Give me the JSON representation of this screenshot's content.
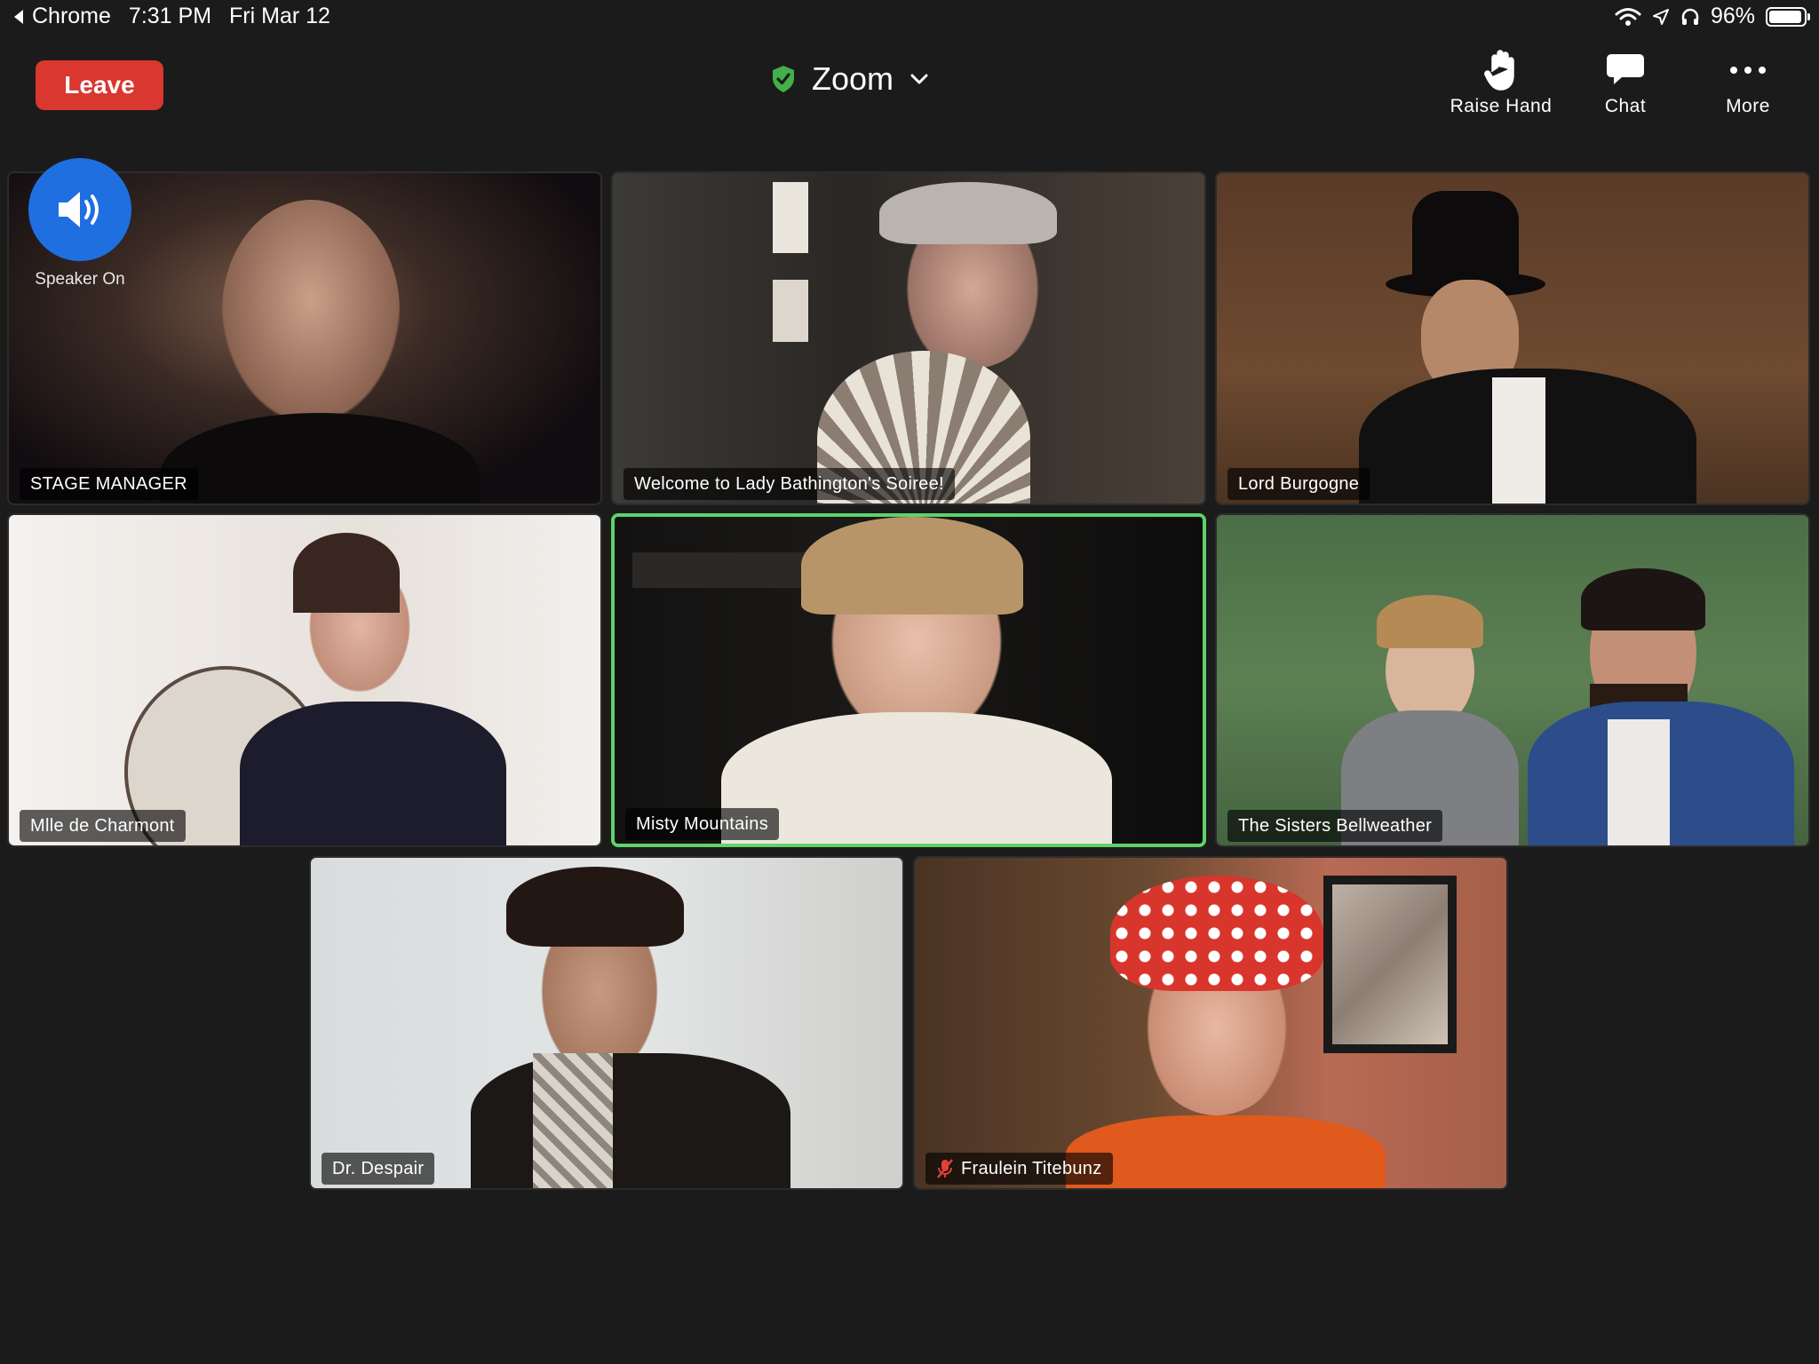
{
  "status_bar": {
    "back_app": "Chrome",
    "time": "7:31 PM",
    "date": "Fri Mar 12",
    "battery": "96%",
    "battery_level": 0.96
  },
  "meeting": {
    "leave_label": "Leave",
    "title": "Zoom"
  },
  "toolbar": {
    "raise_hand": "Raise Hand",
    "chat": "Chat",
    "more": "More"
  },
  "speaker": {
    "label": "Speaker On"
  },
  "participants": [
    {
      "name": "STAGE MANAGER"
    },
    {
      "name": "Welcome to Lady Bathington's Soiree!"
    },
    {
      "name": "Lord Burgogne"
    },
    {
      "name": "Mlle de Charmont"
    },
    {
      "name": "Misty Mountains",
      "active_speaker": true
    },
    {
      "name": "The Sisters Bellweather"
    },
    {
      "name": "Dr. Despair"
    },
    {
      "name": "Fraulein Titebunz",
      "muted": true
    }
  ],
  "icons": {
    "encryption": "shield-check-icon",
    "speaker": "speaker-icon",
    "raise_hand": "hand-icon",
    "chat": "chat-bubble-icon",
    "more": "ellipsis-icon",
    "muted": "mic-muted-icon"
  },
  "colors": {
    "leave": "#d9372f",
    "active_border": "#5ed36a",
    "speaker_button": "#1f6fe0",
    "shield": "#43b04a",
    "muted_icon": "#e0403a"
  }
}
